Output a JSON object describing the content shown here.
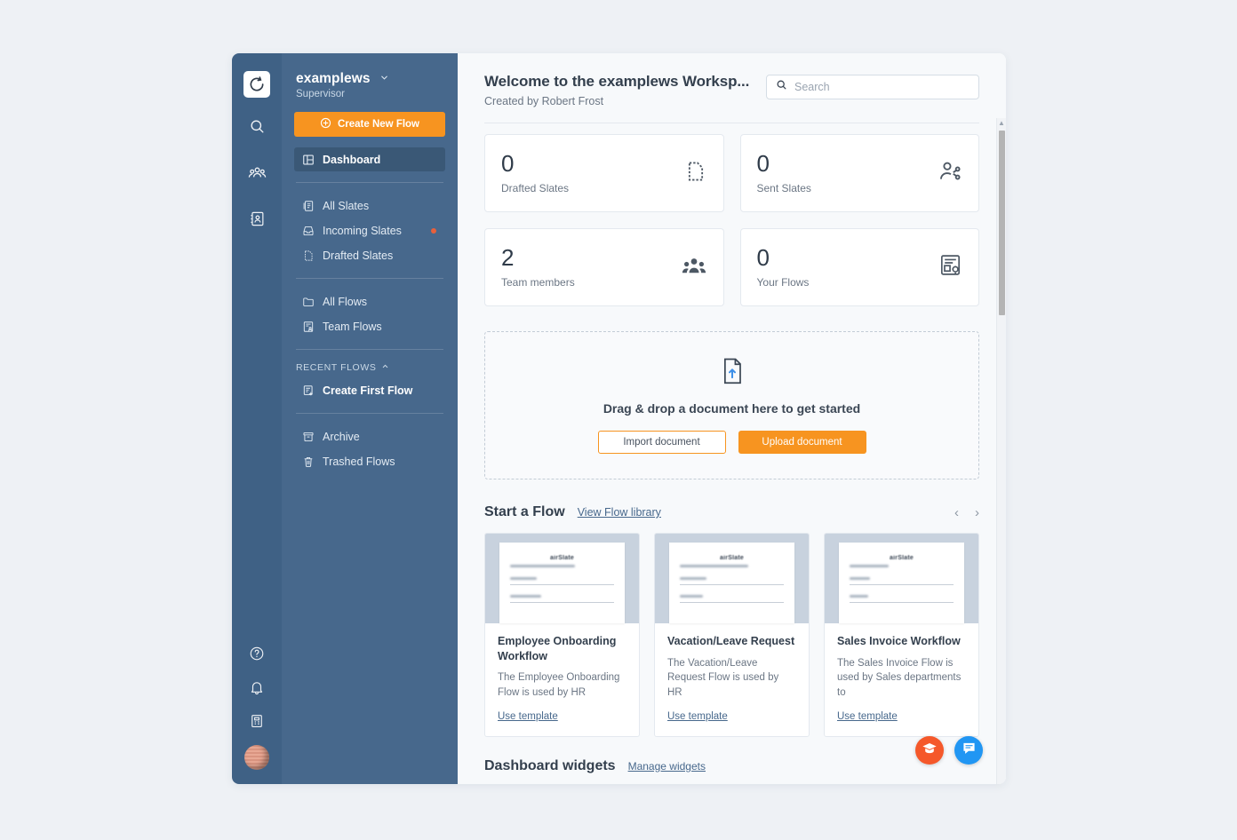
{
  "rail": {
    "logo": "refresh-logo",
    "top_icons": [
      {
        "name": "search-icon",
        "label": "Search"
      },
      {
        "name": "team-icon",
        "label": "Team"
      },
      {
        "name": "contacts-icon",
        "label": "Contacts"
      }
    ],
    "bottom_icons": [
      {
        "name": "help-icon",
        "label": "Help"
      },
      {
        "name": "bell-icon",
        "label": "Notifications"
      },
      {
        "name": "clipboard-icon",
        "label": "Tasks"
      }
    ],
    "avatar": "user-avatar"
  },
  "sidebar": {
    "workspace_name": "examplews",
    "role": "Supervisor",
    "create_button": "Create New Flow",
    "active_item": "Dashboard",
    "group_slates": [
      {
        "label": "All Slates",
        "icon": "slates-icon",
        "badge": false
      },
      {
        "label": "Incoming Slates",
        "icon": "inbox-icon",
        "badge": true
      },
      {
        "label": "Drafted Slates",
        "icon": "draft-doc-icon",
        "badge": false
      }
    ],
    "group_flows": [
      {
        "label": "All Flows",
        "icon": "folder-icon",
        "badge": false
      },
      {
        "label": "Team Flows",
        "icon": "team-flow-icon",
        "badge": false
      }
    ],
    "recent_flows_heading": "RECENT FLOWS",
    "group_recent": [
      {
        "label": "Create First Flow",
        "icon": "add-flow-icon",
        "badge": false
      }
    ],
    "group_archive": [
      {
        "label": "Archive",
        "icon": "archive-icon",
        "badge": false
      },
      {
        "label": "Trashed Flows",
        "icon": "trash-icon",
        "badge": false
      }
    ]
  },
  "header": {
    "title": "Welcome to the examplews Worksp...",
    "subtitle": "Created by Robert Frost",
    "search_placeholder": "Search",
    "search_value": ""
  },
  "stats": [
    {
      "value": "0",
      "label": "Drafted Slates",
      "icon": "dashed-document-icon"
    },
    {
      "value": "0",
      "label": "Sent Slates",
      "icon": "user-share-icon"
    },
    {
      "value": "2",
      "label": "Team members",
      "icon": "people-group-icon"
    },
    {
      "value": "0",
      "label": "Your Flows",
      "icon": "flow-settings-icon"
    }
  ],
  "dropzone": {
    "icon": "document-upload-icon",
    "title": "Drag & drop a document here to get started",
    "import_label": "Import document",
    "upload_label": "Upload document"
  },
  "start_a_flow": {
    "title": "Start a Flow",
    "link": "View Flow library",
    "prev_arrow": "‹",
    "next_arrow": "›",
    "templates": [
      {
        "thumb_brand": "airSlate",
        "thumb_subtitle": "Employee Onboarding Workflow",
        "name": "Employee Onboarding Workflow",
        "description": "The Employee Onboarding Flow is used by HR",
        "cta": "Use template"
      },
      {
        "thumb_brand": "airSlate",
        "thumb_subtitle": "Vacation/Leave Request Flow",
        "name": "Vacation/Leave Request",
        "description": "The Vacation/Leave Request Flow is used by HR",
        "cta": "Use template"
      },
      {
        "thumb_brand": "airSlate",
        "thumb_subtitle": "Sales Invoice Flow",
        "name": "Sales Invoice Workflow",
        "description": "The Sales Invoice Flow is used by Sales departments to",
        "cta": "Use template"
      }
    ]
  },
  "widgets": {
    "title": "Dashboard widgets",
    "link": "Manage widgets"
  },
  "fab": [
    {
      "name": "learning-center-fab",
      "icon": "graduation-cap-icon",
      "color": "#f5582a"
    },
    {
      "name": "chat-fab",
      "icon": "chat-bubble-icon",
      "color": "#2196f3"
    }
  ],
  "colors": {
    "accent_orange": "#f79420",
    "sidebar_blue": "#47688c",
    "rail_blue": "#3f6185",
    "active_nav": "#3a5876",
    "badge_red": "#e8603c",
    "link_blue": "#47688c"
  }
}
